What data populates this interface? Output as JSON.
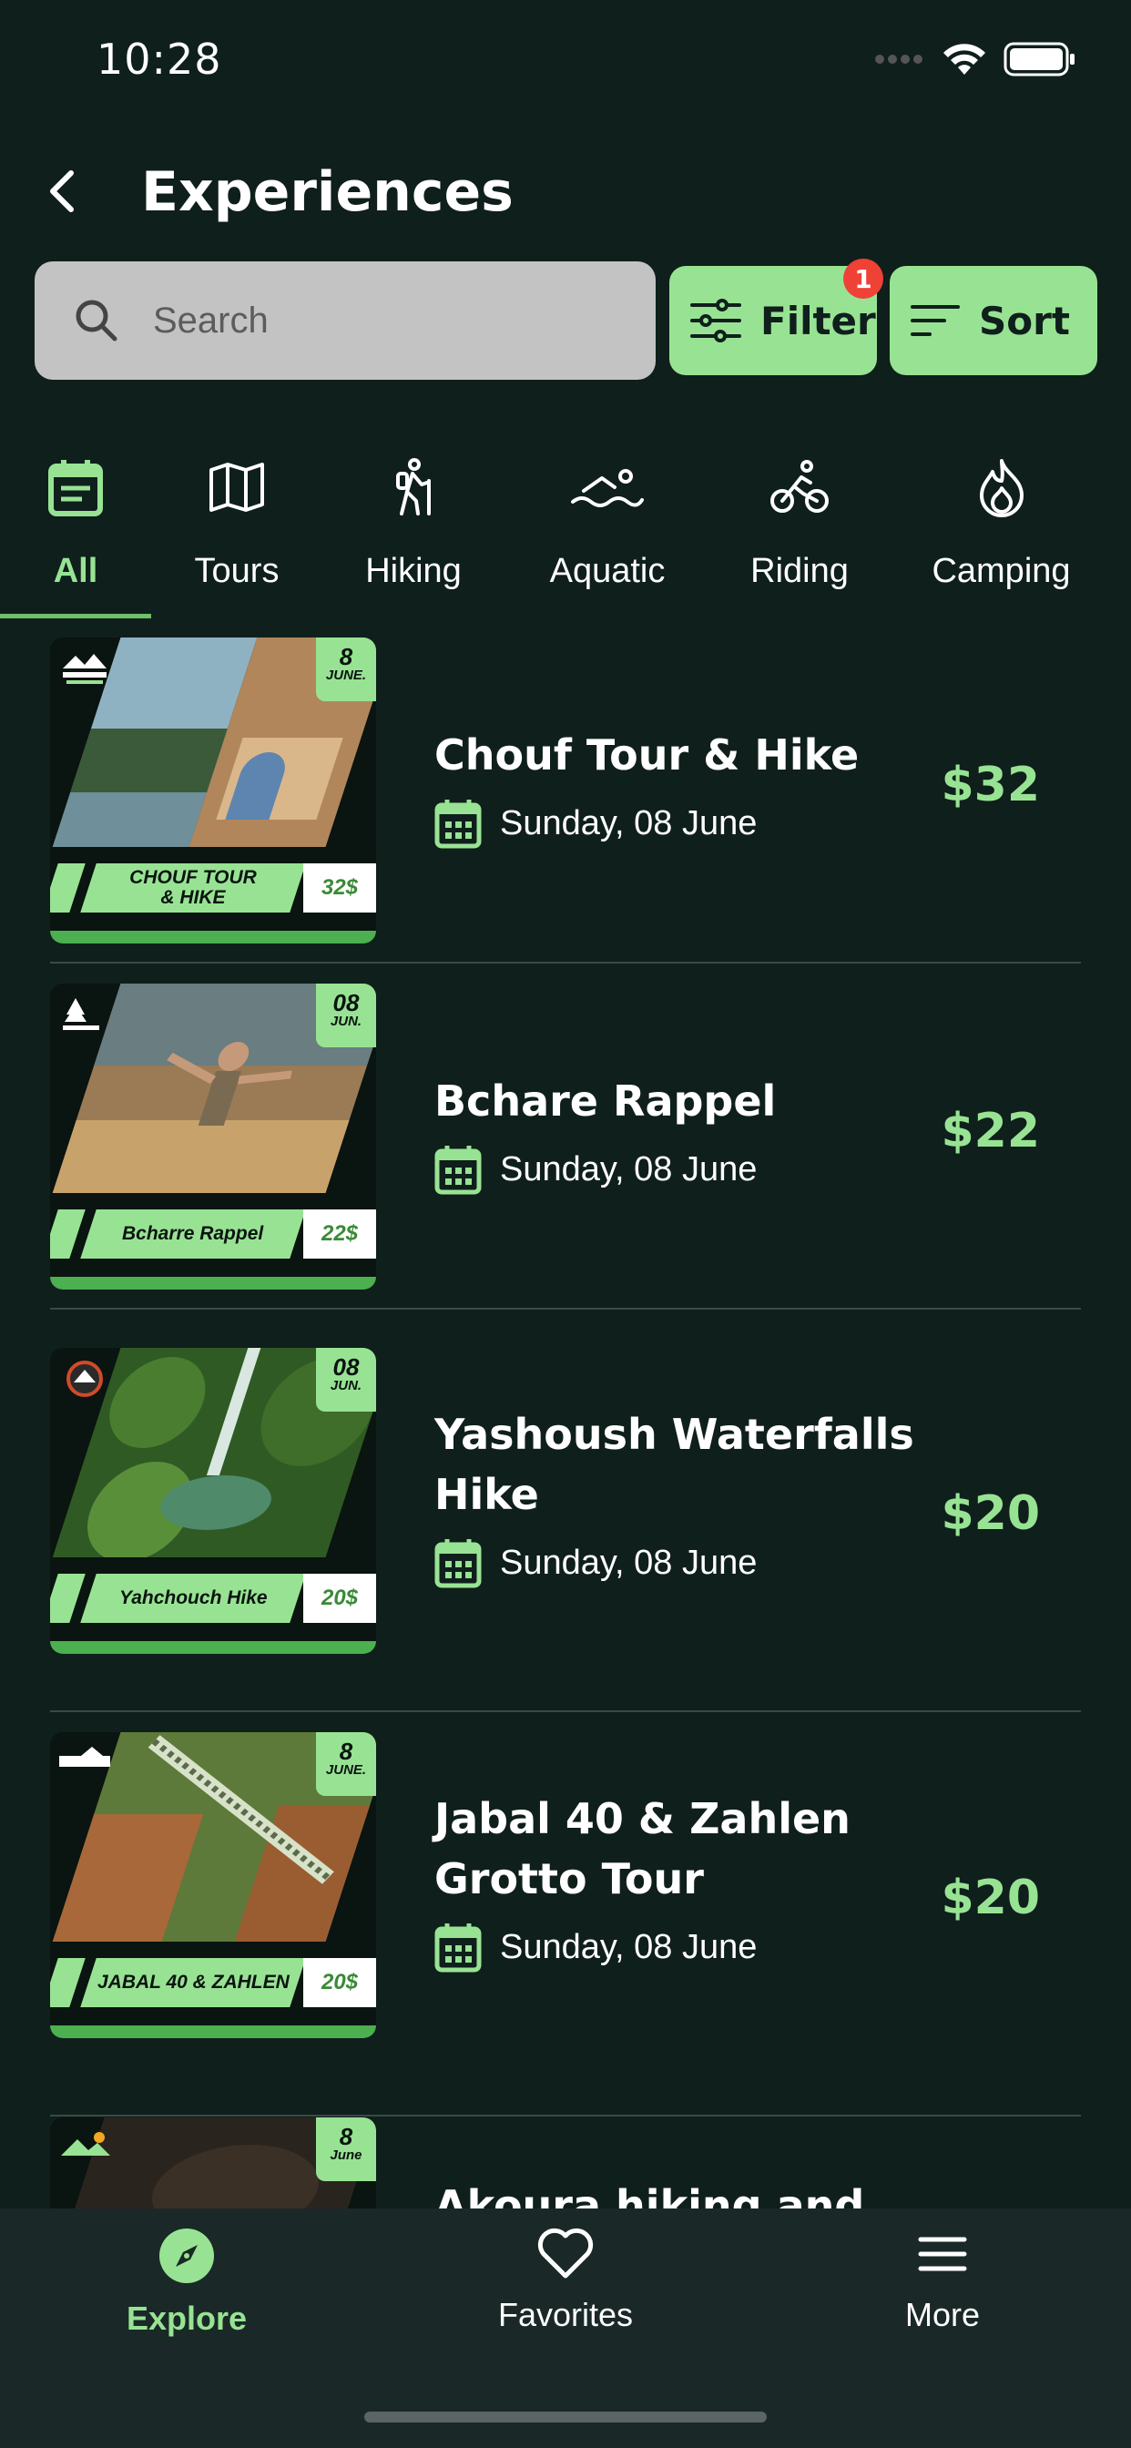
{
  "status_bar": {
    "time": "10:28",
    "icons": [
      "cellular-icon",
      "wifi-icon",
      "battery-icon"
    ]
  },
  "header": {
    "title": "Experiences",
    "back_icon": "chevron-left-icon"
  },
  "search": {
    "placeholder": "Search",
    "value": ""
  },
  "filter": {
    "label": "Filter",
    "badge": "1"
  },
  "sort": {
    "label": "Sort"
  },
  "categories": [
    {
      "label": "All",
      "icon": "calendar-list-icon",
      "active": true
    },
    {
      "label": "Tours",
      "icon": "map-icon",
      "active": false
    },
    {
      "label": "Hiking",
      "icon": "hiker-icon",
      "active": false
    },
    {
      "label": "Aquatic",
      "icon": "swimmer-icon",
      "active": false
    },
    {
      "label": "Riding",
      "icon": "bicycle-icon",
      "active": false
    },
    {
      "label": "Camping",
      "icon": "fire-icon",
      "active": false
    }
  ],
  "experiences": [
    {
      "title": "Chouf Tour &  Hike",
      "date": "Sunday, 08 June",
      "price": "$32",
      "thumb": {
        "day": "8",
        "month": "JUNE.",
        "banner": "CHOUF TOUR & HIKE",
        "banner_price": "32$"
      }
    },
    {
      "title": "Bchare Rappel",
      "date": "Sunday, 08 June",
      "price": "$22",
      "thumb": {
        "day": "08",
        "month": "JUN.",
        "banner": "Bcharre Rappel",
        "banner_price": "22$"
      }
    },
    {
      "title": "Yashoush Waterfalls Hike",
      "date": "Sunday, 08 June",
      "price": "$20",
      "thumb": {
        "day": "08",
        "month": "JUN.",
        "banner": "Yahchouch Hike",
        "banner_price": "20$"
      }
    },
    {
      "title": "Jabal 40 & Zahlen Grotto Tour",
      "date": "Sunday, 08 June",
      "price": "$20",
      "thumb": {
        "day": "8",
        "month": "JUNE.",
        "banner": "JABAL 40 & ZAHLEN",
        "banner_price": "20$"
      }
    },
    {
      "title": "Akoura hiking and",
      "date": "",
      "price": "",
      "thumb": {
        "day": "8",
        "month": "June",
        "banner": "",
        "banner_price": ""
      }
    }
  ],
  "bottom_nav": [
    {
      "label": "Explore",
      "icon": "compass-icon",
      "active": true
    },
    {
      "label": "Favorites",
      "icon": "heart-icon",
      "active": false
    },
    {
      "label": "More",
      "icon": "menu-icon",
      "active": false
    }
  ],
  "colors": {
    "background": "#0f1f1c",
    "accent": "#98e393",
    "badge": "#ef4136",
    "nav_bg": "#1a2927"
  }
}
